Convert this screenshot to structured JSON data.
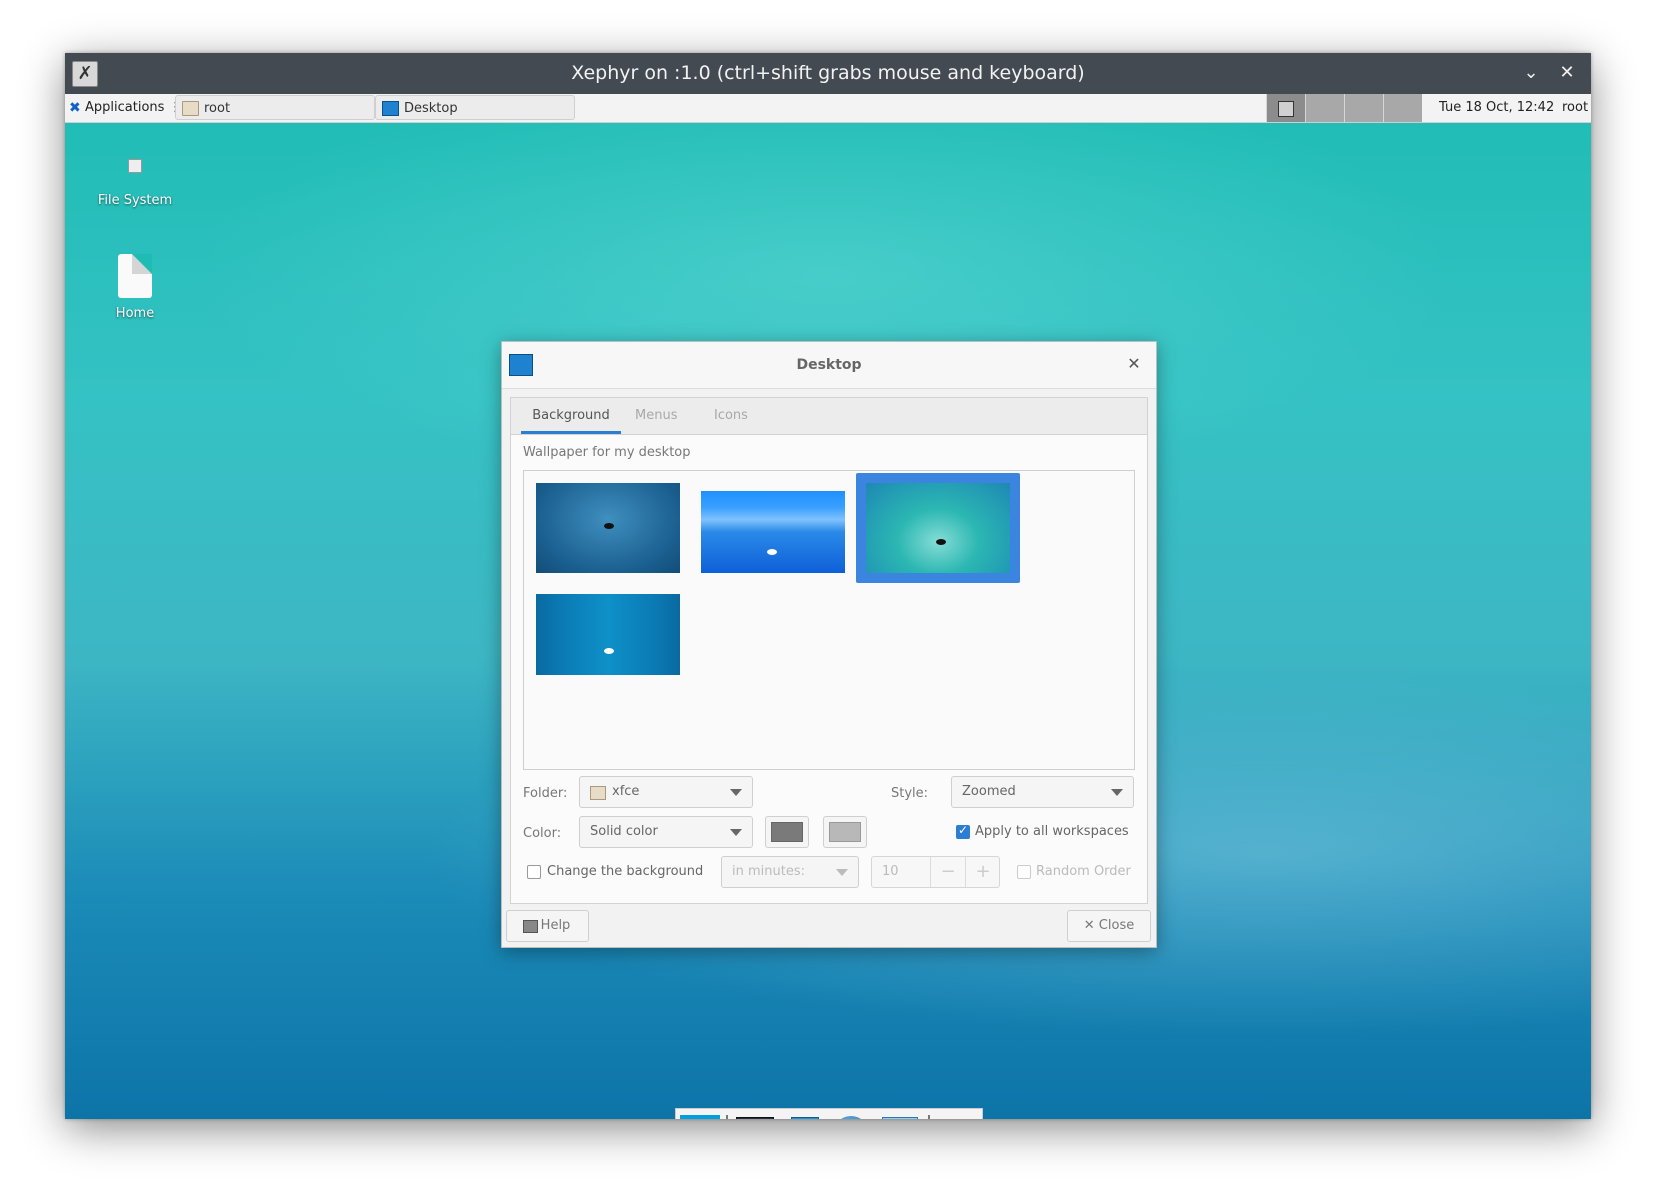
{
  "host_window": {
    "title": "Xephyr on :1.0 (ctrl+shift grabs mouse and keyboard)"
  },
  "panel": {
    "applications_label": "Applications",
    "tasks": [
      {
        "label": "root",
        "icon": "folder-icon"
      },
      {
        "label": "Desktop",
        "icon": "desktop-settings-icon"
      }
    ],
    "workspaces": 4,
    "active_workspace": 1,
    "clock": "Tue 18 Oct, 12:42",
    "user": "root"
  },
  "desktop_icons": [
    {
      "label": "File System",
      "icon": "drive-icon"
    },
    {
      "label": "Home",
      "icon": "home-folder-icon"
    }
  ],
  "dock": {
    "items": [
      "show-desktop-icon",
      "terminal-icon",
      "file-manager-icon",
      "web-browser-icon",
      "app-finder-icon",
      "folder-icon"
    ]
  },
  "dialog": {
    "title": "Desktop",
    "tabs": [
      "Background",
      "Menus",
      "Icons"
    ],
    "active_tab": "Background",
    "wallpaper_label": "Wallpaper for my desktop",
    "wallpapers_selected_index": 2,
    "folder_label": "Folder:",
    "folder_value": "xfce",
    "style_label": "Style:",
    "style_value": "Zoomed",
    "color_label": "Color:",
    "color_value": "Solid color",
    "primary_color": "#7a7a7a",
    "secondary_color": "#b8b8b8",
    "apply_all_label": "Apply to all workspaces",
    "apply_all_checked": true,
    "change_bg_label": "Change the background",
    "change_bg_checked": false,
    "interval_value": "in minutes:",
    "interval_amount": "10",
    "random_order_label": "Random Order",
    "random_order_checked": false,
    "help_label": "Help",
    "close_label": "Close"
  },
  "colors": {
    "accent": "#2d7ed3",
    "titlebar": "#444a52"
  }
}
